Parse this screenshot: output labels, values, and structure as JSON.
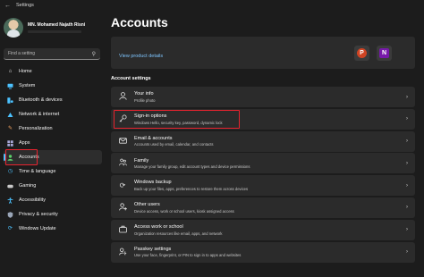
{
  "window": {
    "title": "Settings"
  },
  "profile": {
    "name": "MN. Mohamed Najath Risni"
  },
  "search": {
    "placeholder": "Find a setting"
  },
  "sidebar": {
    "items": [
      {
        "label": "Home",
        "icon": "home-icon",
        "color": "#e8e8e8"
      },
      {
        "label": "System",
        "icon": "monitor-icon",
        "color": "#4cc2ff"
      },
      {
        "label": "Bluetooth & devices",
        "icon": "bluetooth-icon",
        "color": "#4cc2ff"
      },
      {
        "label": "Network & internet",
        "icon": "wifi-icon",
        "color": "#4cc2ff"
      },
      {
        "label": "Personalization",
        "icon": "brush-icon",
        "color": "#f4a460"
      },
      {
        "label": "Apps",
        "icon": "apps-icon",
        "color": "#a9a9d9"
      },
      {
        "label": "Accounts",
        "icon": "person-icon",
        "color": "#5bd16a",
        "active": true
      },
      {
        "label": "Time & language",
        "icon": "globe-clock-icon",
        "color": "#4cc2ff"
      },
      {
        "label": "Gaming",
        "icon": "gamepad-icon",
        "color": "#c9c9c9"
      },
      {
        "label": "Accessibility",
        "icon": "accessibility-icon",
        "color": "#4cc2ff"
      },
      {
        "label": "Privacy & security",
        "icon": "shield-icon",
        "color": "#9aa6b8"
      },
      {
        "label": "Windows Update",
        "icon": "update-icon",
        "color": "#4cc2ff"
      }
    ]
  },
  "main": {
    "title": "Accounts",
    "product_link": "View product details",
    "section_heading": "Account settings",
    "rows": [
      {
        "title": "Your info",
        "subtitle": "Profile photo",
        "icon": "person-icon"
      },
      {
        "title": "Sign-in options",
        "subtitle": "Windows Hello, security key, password, dynamic lock",
        "icon": "key-icon"
      },
      {
        "title": "Email & accounts",
        "subtitle": "Accounts used by email, calendar, and contacts",
        "icon": "mail-icon"
      },
      {
        "title": "Family",
        "subtitle": "Manage your family group, edit account types and device permissions",
        "icon": "family-icon"
      },
      {
        "title": "Windows backup",
        "subtitle": "Back up your files, apps, preferences to restore them across devices",
        "icon": "backup-icon"
      },
      {
        "title": "Other users",
        "subtitle": "Device access, work or school users, kiosk assigned access",
        "icon": "add-user-icon"
      },
      {
        "title": "Access work or school",
        "subtitle": "Organization resources like email, apps, and network",
        "icon": "briefcase-icon"
      },
      {
        "title": "Passkey settings",
        "subtitle": "Use your face, fingerprint, or PIN to sign in to apps and websites",
        "icon": "passkey-icon"
      }
    ]
  },
  "colors": {
    "accent": "#4cc2ff",
    "highlight_box": "#e8232e",
    "link": "#7fc6ff"
  }
}
